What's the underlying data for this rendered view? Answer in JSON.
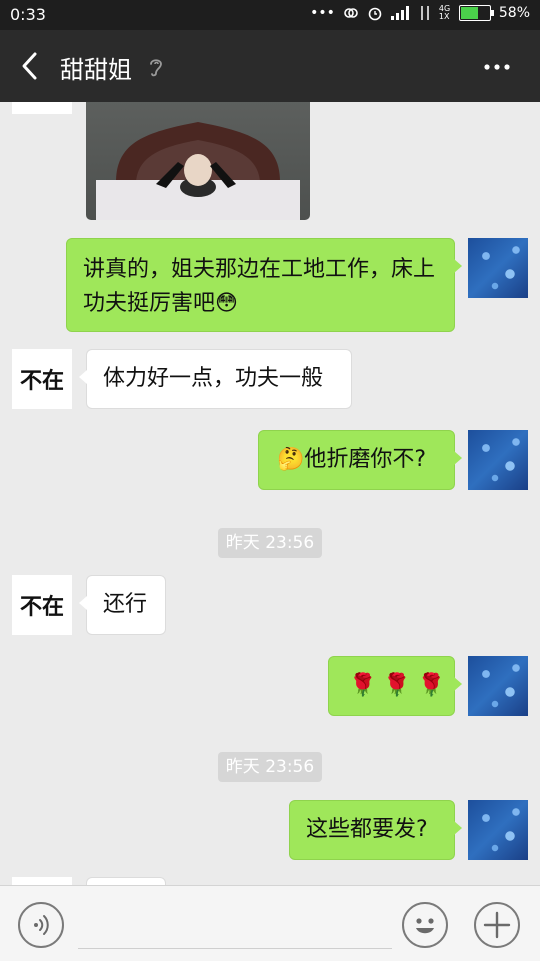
{
  "status_bar": {
    "time": "0:33",
    "network_label": "4G 1X",
    "battery": "58%"
  },
  "header": {
    "title": "甜甜姐"
  },
  "messages": [
    {
      "side": "out",
      "text": "讲真的，姐夫那边在工地工作，床上功夫挺厉害吧",
      "emoji": "😳"
    },
    {
      "side": "in",
      "avatar_text": "不在",
      "text": "体力好一点，功夫一般"
    },
    {
      "side": "out",
      "emoji": "🤔",
      "text": "他折磨你不?"
    },
    {
      "timestamp": "昨天 23:56"
    },
    {
      "side": "in",
      "avatar_text": "不在",
      "text": "还行"
    },
    {
      "side": "out",
      "text": "🌹 🌹 🌹"
    },
    {
      "timestamp": "昨天 23:56"
    },
    {
      "side": "out",
      "text": "这些都要发?"
    }
  ],
  "input": {
    "placeholder": ""
  },
  "icons": [
    "back-arrow-icon",
    "ear-icon",
    "more-icon",
    "voice-icon",
    "emoji-icon",
    "plus-icon"
  ],
  "colors": {
    "outgoing_bubble": "#9fe75a",
    "incoming_bubble": "#ffffff",
    "header_bg": "#2b2b2b",
    "status_bar_bg": "#1e1e1e",
    "chat_bg": "#ebebeb"
  }
}
